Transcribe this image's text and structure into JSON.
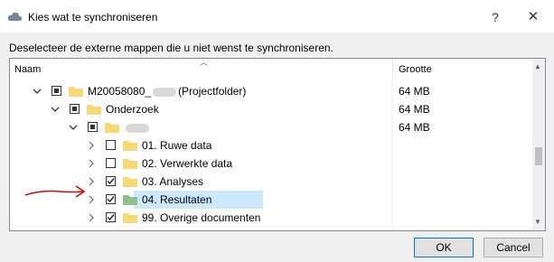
{
  "window": {
    "title": "Kies wat te synchroniseren",
    "help_label": "?",
    "close_label": "✕"
  },
  "instruction": "Deselecteer de externe mappen die u niet wenst te synchroniseren.",
  "columns": {
    "name": "Naam",
    "size": "Grootte"
  },
  "rows": [
    {
      "name_prefix": "M20058080_",
      "name_suffix": "(Projectfolder)",
      "size": "64 MB",
      "check": "partial",
      "expanded": true
    },
    {
      "name": "Onderzoek",
      "size": "64 MB",
      "check": "partial",
      "expanded": true
    },
    {
      "name": "",
      "size": "64 MB",
      "check": "partial",
      "expanded": true
    },
    {
      "name": "01. Ruwe data",
      "size": "",
      "check": "unchecked",
      "expanded": false
    },
    {
      "name": "02. Verwerkte data",
      "size": "",
      "check": "unchecked",
      "expanded": false
    },
    {
      "name": "03. Analyses",
      "size": "",
      "check": "checked",
      "expanded": false
    },
    {
      "name": "04. Resultaten",
      "size": "",
      "check": "checked",
      "expanded": false,
      "selected": true
    },
    {
      "name": "99. Overige documenten",
      "size": "",
      "check": "checked",
      "expanded": false
    }
  ],
  "buttons": {
    "ok": "OK",
    "cancel": "Cancel"
  },
  "icons": [
    "cloud-icon",
    "folder-icon",
    "chevron-down-icon",
    "chevron-right-icon",
    "checkbox-icon",
    "arrow-annotation-icon"
  ],
  "colors": {
    "selection": "#cce8ff",
    "folder": "#f8d775",
    "folder_selected": "#8fbf8f",
    "annotation": "#e00000"
  }
}
